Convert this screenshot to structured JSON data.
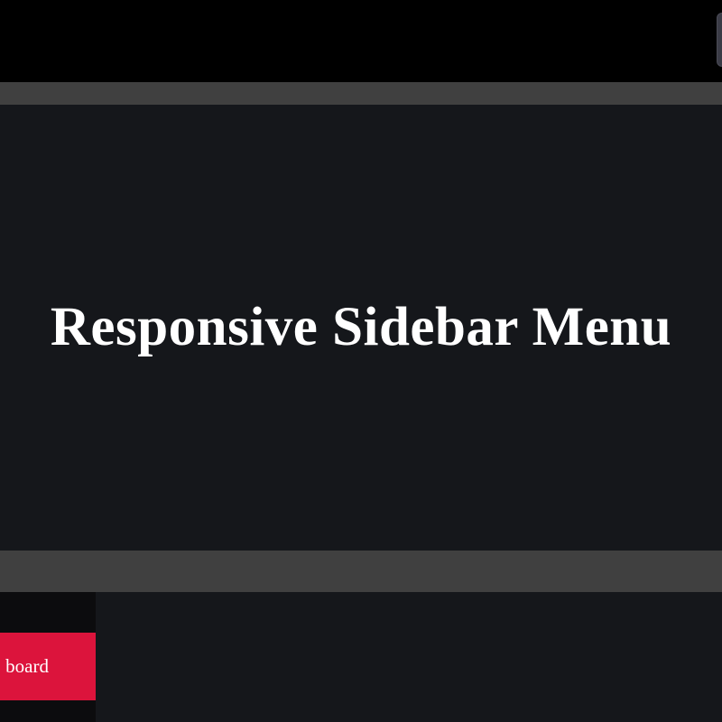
{
  "hero": {
    "title": "Responsive Sidebar Menu"
  },
  "sidebar": {
    "items": [
      {
        "label": "Dashboard",
        "visible_text": "board",
        "active": true,
        "color": "#dc143c"
      }
    ]
  },
  "colors": {
    "background": "#15171b",
    "topbar": "#000000",
    "band": "#404040",
    "sidebar": "#0c0c0e",
    "accent": "#dc143c",
    "text": "#ffffff"
  },
  "icons": {
    "toggle": "menu-toggle-icon"
  }
}
